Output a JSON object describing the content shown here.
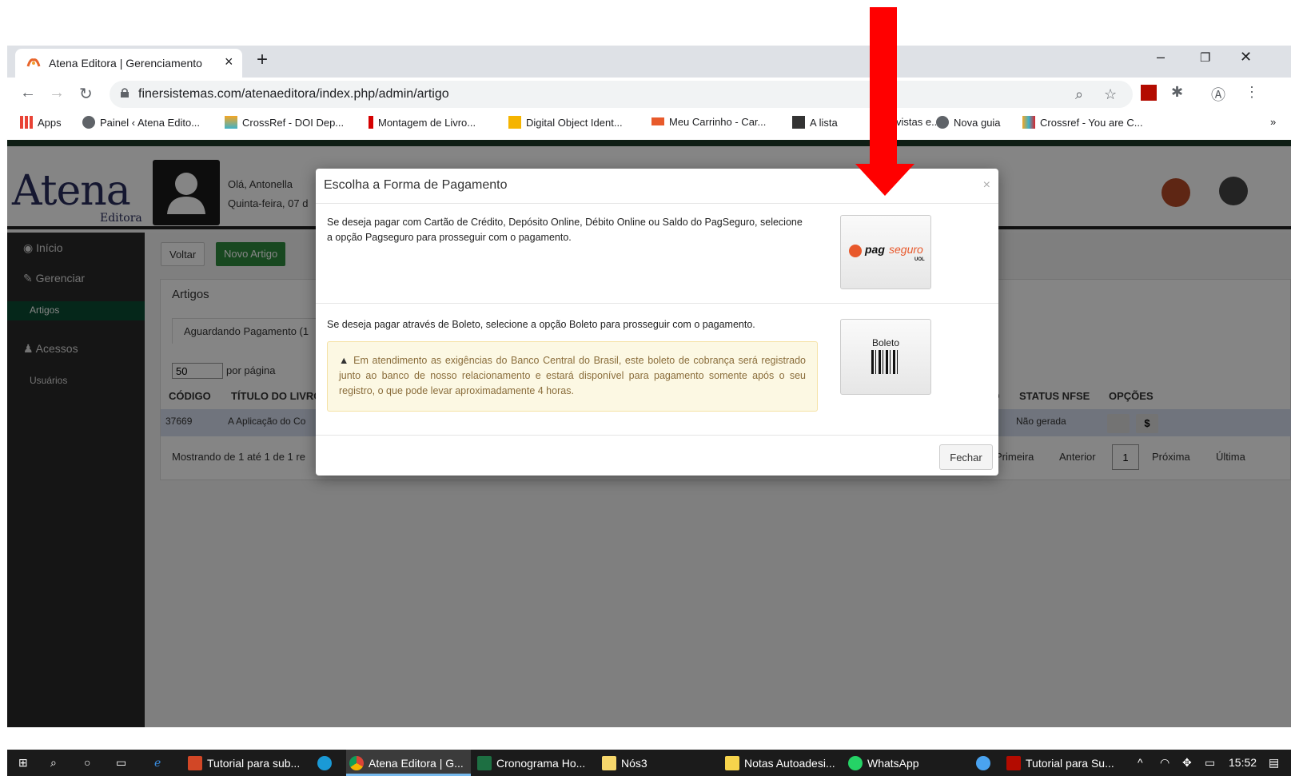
{
  "browser": {
    "tab_title": "Atena Editora | Gerenciamento",
    "tab_close": "×",
    "new_tab": "+",
    "url": "finersistemas.com/atenaeditora/index.php/admin/artigo",
    "minimize": "–",
    "restore": "❐",
    "close": "✕",
    "more": "⋮",
    "bookmarks": [
      "Apps",
      "Painel ‹ Atena Edito...",
      "CrossRef - DOI Dep...",
      "Montagem de Livro...",
      "Digital Object Ident...",
      "Meu Carrinho - Car...",
      "A lista",
      "vistas e...",
      "Nova guia",
      "Crossref - You are C..."
    ],
    "bookmarks_overflow": "»"
  },
  "header": {
    "logo": "Atena",
    "logo_sub": "Editora",
    "greeting": "Olá, Antonella",
    "date": "Quinta-feira, 07 d"
  },
  "sidebar": {
    "inicio": "Início",
    "gerenciar": "Gerenciar",
    "artigos": "Artigos",
    "acessos": "Acessos",
    "usuarios": "Usuários"
  },
  "content": {
    "voltar": "Voltar",
    "novo_artigo": "Novo Artigo",
    "panel_title": "Artigos",
    "tab_aguardando": "Aguardando Pagamento (1",
    "per_page_value": "50",
    "per_page_label": "por página",
    "col_codigo": "CÓDIGO",
    "col_titulo": "TÍTULO DO LIVRO",
    "col_do": "DO",
    "col_status_nfse": "STATUS NFSE",
    "col_opcoes": "OPÇÕES",
    "row_code": "37669",
    "row_title": "A Aplicação do Co",
    "row_status": "Não gerada",
    "row_btn_dollar": "$",
    "showing": "Mostrando de 1 até 1 de 1 re",
    "pag_primeira": "Primeira",
    "pag_anterior": "Anterior",
    "pag_current": "1",
    "pag_proxima": "Próxima",
    "pag_ultima": "Última"
  },
  "modal": {
    "title": "Escolha a Forma de Pagamento",
    "close_x": "×",
    "pagseguro_text": "Se deseja pagar com Cartão de Crédito, Depósito Online, Débito Online ou Saldo do PagSeguro, selecione a opção Pagseguro para prosseguir com o pagamento.",
    "pagseguro_logo_a": "pag",
    "pagseguro_logo_b": "seguro",
    "pagseguro_logo_uol": "UOL",
    "boleto_text": "Se deseja pagar através de Boleto, selecione a opção Boleto para prosseguir com o pagamento.",
    "boleto_label": "Boleto",
    "alert_text": "Em atendimento as exigências do Banco Central do Brasil, este boleto de cobrança será registrado junto ao banco de nosso relacionamento e estará disponível para pagamento somente após o seu registro, o que pode levar aproximadamente 4 horas.",
    "fechar": "Fechar"
  },
  "taskbar": {
    "items": [
      "Tutorial para sub...",
      "Atena Editora | G...",
      "Cronograma Ho...",
      "Nós3",
      "Notas Autoadesi...",
      "WhatsApp",
      "Tutorial para Su..."
    ],
    "time": "15:52"
  },
  "colors": {
    "accent_green": "#2e8b3e",
    "arrow_red": "#ff0000",
    "sidebar_active": "#0b4c32"
  }
}
